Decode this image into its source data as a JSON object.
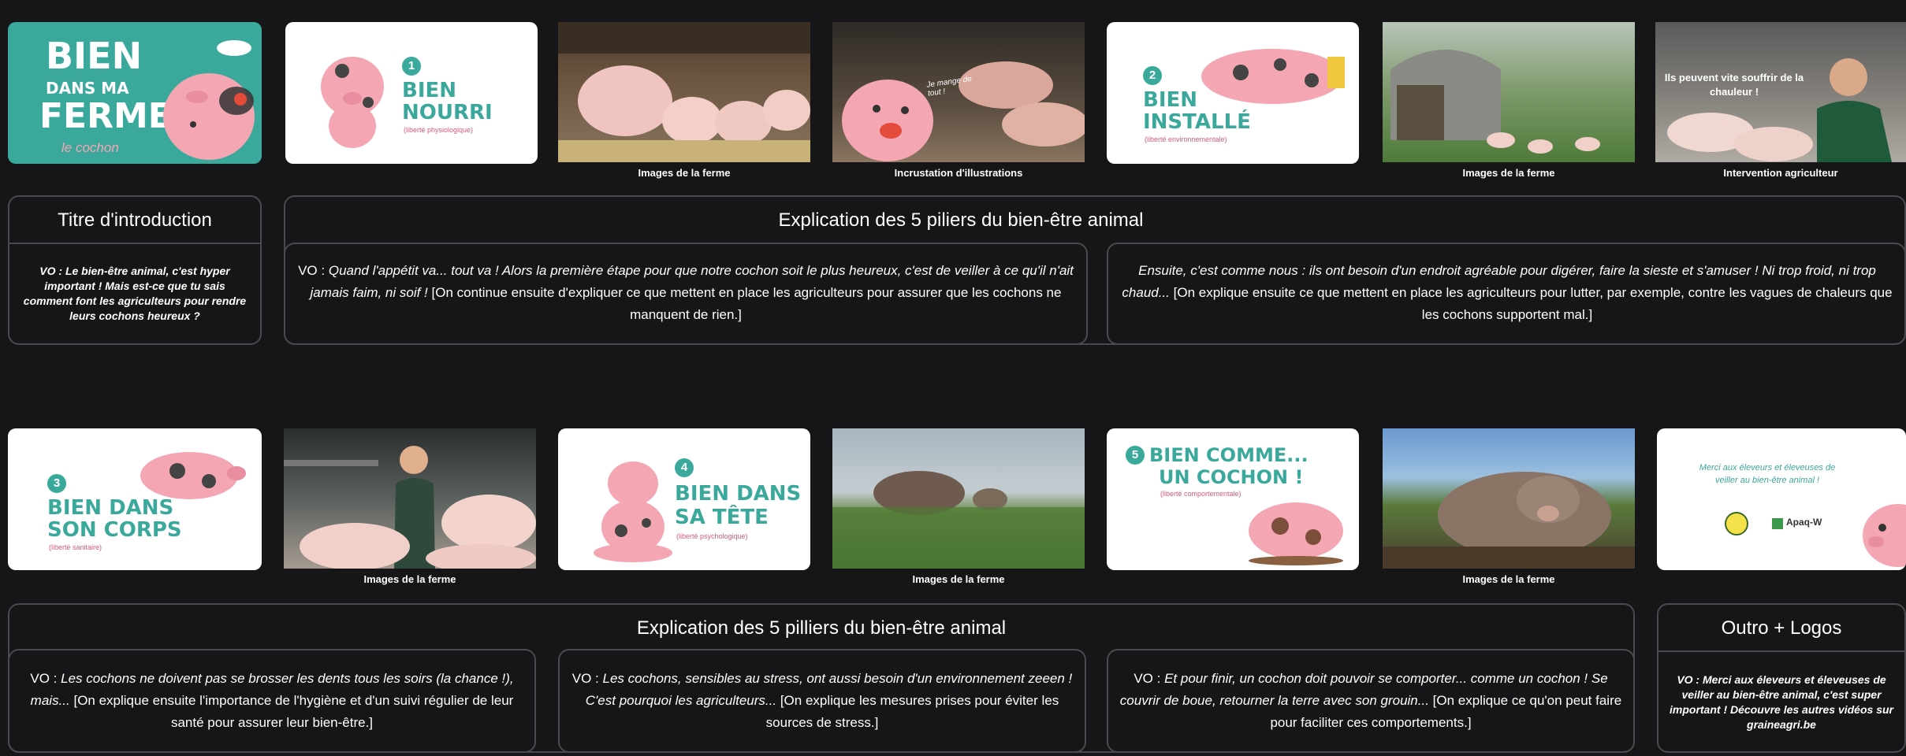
{
  "slides": {
    "intro_title_card": {
      "line1": "BIEN",
      "line2": "DANS MA",
      "line3": "FERME",
      "subtitle": "le cochon"
    },
    "pillar1": {
      "number": "1",
      "line1": "BIEN",
      "line2": "NOURRI",
      "tag": "(liberté physiologique)"
    },
    "pillar2": {
      "number": "2",
      "line1": "BIEN",
      "line2": "INSTALLÉ",
      "tag": "(liberté environnementale)"
    },
    "pillar3": {
      "number": "3",
      "line1": "BIEN DANS",
      "line2": "SON CORPS",
      "tag": "(liberté sanitaire)"
    },
    "pillar4": {
      "number": "4",
      "line1": "BIEN DANS",
      "line2": "SA TÊTE",
      "tag": "(liberté psychologique)"
    },
    "pillar5": {
      "number": "5",
      "line1": "BIEN COMME...",
      "line2": "UN COCHON !",
      "tag": "(liberté comportementale)"
    },
    "illustration_bubble": "Je mange de tout !",
    "farmer_bubble": "Ils peuvent vite souffrir de la chauleur !",
    "outro": {
      "thanks": "Merci aux éleveurs et éleveuses de veiller au bien-être animal !",
      "logo": "Apaq-W"
    }
  },
  "captions": {
    "farm_images": "Images de la ferme",
    "illustrations": "Incrustation d'illustrations",
    "farmer": "Intervention agriculteur"
  },
  "sections": {
    "intro_title": "Titre d'introduction",
    "pillars_title_1": "Explication des 5 piliers du bien-être animal",
    "pillars_title_2": "Explication des 5 pilliers du bien-être animal",
    "outro_title": "Outro + Logos"
  },
  "vo": {
    "intro": {
      "label": "VO :",
      "text": "Le bien-être animal, c'est hyper important ! Mais est-ce que tu sais comment font les agriculteurs pour rendre leurs cochons heureux ?"
    },
    "p1": {
      "label": "VO :",
      "italic": "Quand l'appétit va... tout va ! Alors la première étape pour que notre cochon soit le plus heureux, c'est de veiller à ce qu'il n'ait jamais faim, ni soif !",
      "note": "[On continue ensuite d'expliquer ce que mettent en place les agriculteurs pour assurer que les cochons ne manquent de rien.]"
    },
    "p2": {
      "italic": "Ensuite, c'est comme nous : ils ont besoin d'un endroit agréable pour digérer, faire la sieste et s'amuser ! Ni trop froid, ni trop chaud...",
      "note": "[On explique ensuite ce que mettent en place les agriculteurs pour lutter, par exemple, contre les vagues de chaleurs que les cochons supportent mal.]"
    },
    "p3": {
      "label": "VO :",
      "italic": "Les cochons ne doivent pas se brosser les dents tous les soirs (la chance !), mais...",
      "note": "[On explique ensuite l'importance de l'hygiène et d'un suivi régulier de leur santé pour assurer leur bien-être.]"
    },
    "p4": {
      "label": "VO :",
      "italic": "Les cochons, sensibles au stress, ont aussi besoin d'un environnement zeeen ! C'est pourquoi les agriculteurs...",
      "note": "[On explique les mesures prises pour éviter les sources de stress.]"
    },
    "p5": {
      "label": "VO :",
      "italic": "Et pour finir, un cochon doit pouvoir se comporter... comme un cochon ! Se couvrir de boue, retourner la terre avec son grouin...",
      "note": "[On explique ce qu'on peut faire pour faciliter ces comportements.]"
    },
    "outro": {
      "label": "VO :",
      "text": "Merci aux éleveurs et éleveuses de veiller au bien-être animal, c'est super important ! Découvre les autres vidéos sur graineagri.be"
    }
  },
  "colors": {
    "teal": "#3aa99c",
    "pink": "#f4a6b3",
    "bg": "#161618",
    "border": "#4a4a4e"
  }
}
